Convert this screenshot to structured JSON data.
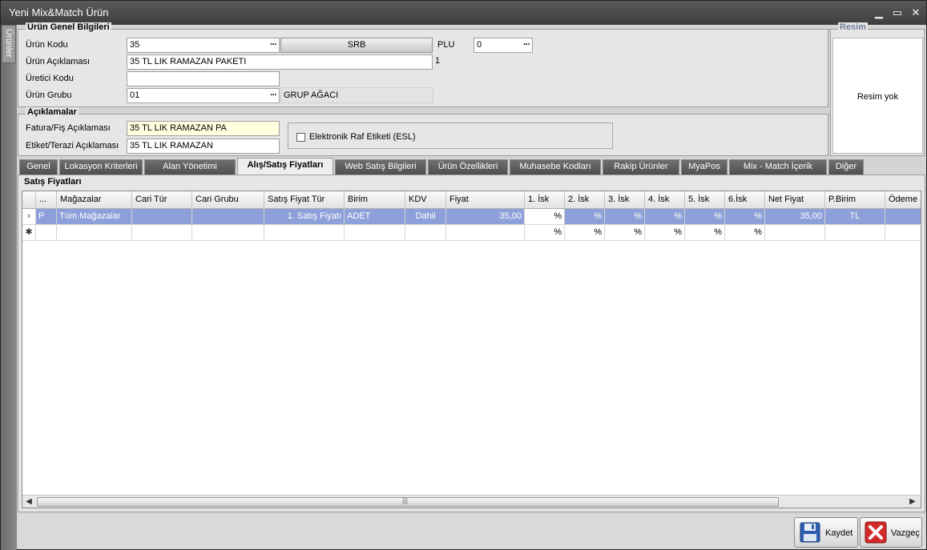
{
  "window": {
    "title": "Yeni Mix&Match Ürün",
    "minimize": "▁",
    "maximize": "▭",
    "close": "✕"
  },
  "sidebar": {
    "tab_label": "Ürünler"
  },
  "general": {
    "group_title": "Ürün Genel Bilgileri",
    "urun_kodu_label": "Ürün Kodu",
    "urun_kodu_value": "35",
    "srb_button": "SRB",
    "plu_label": "PLU",
    "plu_value": "0",
    "aciklama_label": "Ürün Açıklaması",
    "aciklama_value": "35 TL LIK RAMAZAN PAKETI",
    "aciklama_counter": "1",
    "uretici_label": "Üretici Kodu",
    "uretici_value": "",
    "grup_label": "Ürün Grubu",
    "grup_value": "01",
    "grup_agaci": "GRUP AĞACI",
    "dots": "···"
  },
  "image_box": {
    "title": "Resim",
    "empty_text": "Resim yok"
  },
  "descriptions": {
    "group_title": "Açıklamalar",
    "fatura_label": "Fatura/Fiş Açıklaması",
    "fatura_value": "35 TL LIK RAMAZAN PA",
    "etiket_label": "Etiket/Terazi Açıklaması",
    "etiket_value": "35 TL LIK RAMAZAN",
    "esl_label": "Elektronik Raf Etiketi (ESL)"
  },
  "tabs": [
    {
      "label": "Genel"
    },
    {
      "label": "Lokasyon Kriterleri"
    },
    {
      "label": "Alan Yönetimi"
    },
    {
      "label": "Alış/Satış Fiyatları"
    },
    {
      "label": "Web Satış Bilgileri"
    },
    {
      "label": "Ürün Özellikleri"
    },
    {
      "label": "Muhasebe Kodları"
    },
    {
      "label": "Rakip Ürünler"
    },
    {
      "label": "MyaPos"
    },
    {
      "label": "Mix - Match İçerik"
    },
    {
      "label": "Diğer"
    }
  ],
  "grid": {
    "section_title": "Satış Fiyatları",
    "columns": [
      "...",
      "Mağazalar",
      "Cari Tür",
      "Cari Grubu",
      "Satış Fiyat Tür",
      "Birim",
      "KDV",
      "Fiyat",
      "1. İsk",
      "2. İsk",
      "3. İsk",
      "4. İsk",
      "5. İsk",
      "6.İsk",
      "Net Fiyat",
      "P.Birim",
      "Ödeme Ş"
    ],
    "row1": [
      "P",
      "Tüm Mağazalar",
      "",
      "",
      "1. Satış Fiyatı",
      "ADET",
      "Dahil",
      "35,00",
      "%",
      "%",
      "%",
      "%",
      "%",
      "%",
      "35,00",
      "TL",
      ""
    ],
    "row2": [
      "",
      "",
      "",
      "",
      "",
      "",
      "",
      "",
      "%",
      "%",
      "%",
      "%",
      "%",
      "%",
      "",
      "",
      ""
    ],
    "row1_indicator": "›",
    "row2_indicator": "✱",
    "scroll_left": "◀",
    "scroll_right": "▶",
    "scroll_grip": "|||"
  },
  "footer": {
    "save_label": "Kaydet",
    "cancel_label": "Vazgeç"
  }
}
